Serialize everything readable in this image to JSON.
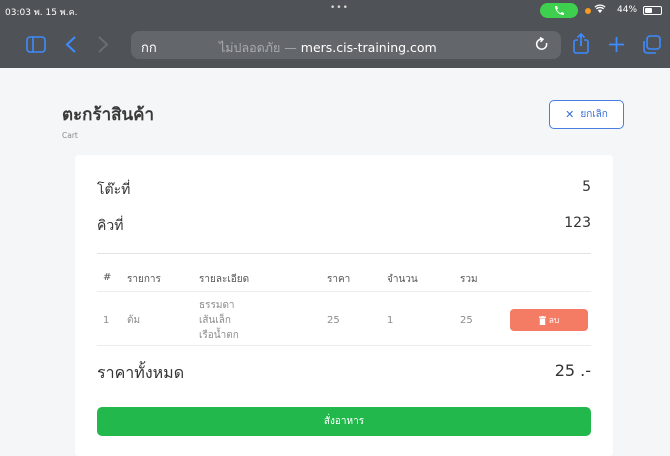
{
  "status_bar": {
    "time": "03:03",
    "date": "พ. 15 พ.ค.",
    "battery": "44%",
    "dots": "•••"
  },
  "browser": {
    "reader_label": "กก",
    "url_prefix": "ไม่ปลอดภัย",
    "url_separator": " — ",
    "url": "mers.cis-training.com"
  },
  "header": {
    "title": "ตะกร้าสินค้า",
    "subtitle": "Cart",
    "cancel_label": "ยกเลิก"
  },
  "summary": {
    "table_label": "โต๊ะที่",
    "table_value": "5",
    "queue_label": "คิวที่",
    "queue_value": "123"
  },
  "cart": {
    "columns": [
      "#",
      "รายการ",
      "รายละเอียด",
      "ราคา",
      "จำนวน",
      "รวม"
    ],
    "rows": [
      {
        "index": "1",
        "item": "ต้ม",
        "details": [
          "ธรรมดา",
          "เส้นเล็ก",
          "เรือน้ำตก"
        ],
        "price": "25",
        "qty": "1",
        "total": "25",
        "delete_label": "ลบ"
      }
    ]
  },
  "total": {
    "label": "ราคาทั้งหมด",
    "value": "25 .-"
  },
  "order_button": "สั่งอาหาร",
  "colors": {
    "chrome": "#4f5256",
    "primary": "#3b6fd8",
    "danger": "#f47c64",
    "success": "#22b84c"
  }
}
